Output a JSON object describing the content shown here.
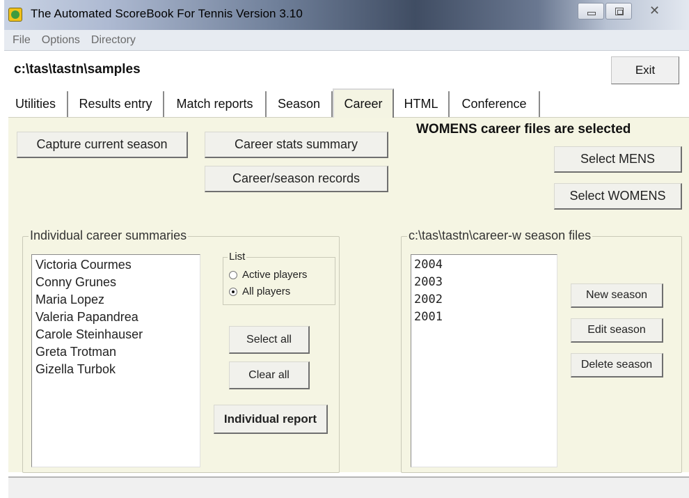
{
  "window": {
    "title": "The Automated ScoreBook For Tennis Version 3.10",
    "icon": "app-icon",
    "controls": {
      "minimize": "minimize-icon",
      "maximize": "maximize-icon",
      "close_glyph": "✕"
    }
  },
  "menu": {
    "items": [
      "File",
      "Options",
      "Directory"
    ]
  },
  "path": "c:\\tas\\tastn\\samples",
  "exit_label": "Exit",
  "tabs": [
    {
      "label": "Utilities"
    },
    {
      "label": "Results entry"
    },
    {
      "label": "Match reports"
    },
    {
      "label": "Season"
    },
    {
      "label": "Career",
      "active": true
    },
    {
      "label": "HTML"
    },
    {
      "label": "Conference"
    }
  ],
  "career": {
    "capture_label": "Capture current season",
    "stats_summary_label": "Career stats summary",
    "records_label": "Career/season records",
    "selection_notice": "WOMENS career files are selected",
    "select_mens_label": "Select MENS",
    "select_womens_label": "Select WOMENS",
    "individual": {
      "legend": "Individual career summaries",
      "players": [
        "Victoria Courmes",
        "Conny Grunes",
        "Maria Lopez",
        "Valeria Papandrea",
        "Carole Steinhauser",
        "Greta Trotman",
        "Gizella Turbok"
      ],
      "list_legend": "List",
      "radio_options": [
        {
          "label": "Active players",
          "checked": false
        },
        {
          "label": "All players",
          "checked": true
        }
      ],
      "select_all_label": "Select all",
      "clear_all_label": "Clear all",
      "report_label": "Individual report"
    },
    "seasons": {
      "legend": "c:\\tas\\tastn\\career-w season files",
      "years": [
        "2004",
        "2003",
        "2002",
        "2001"
      ],
      "new_label": "New season",
      "edit_label": "Edit season",
      "delete_label": "Delete season"
    }
  }
}
